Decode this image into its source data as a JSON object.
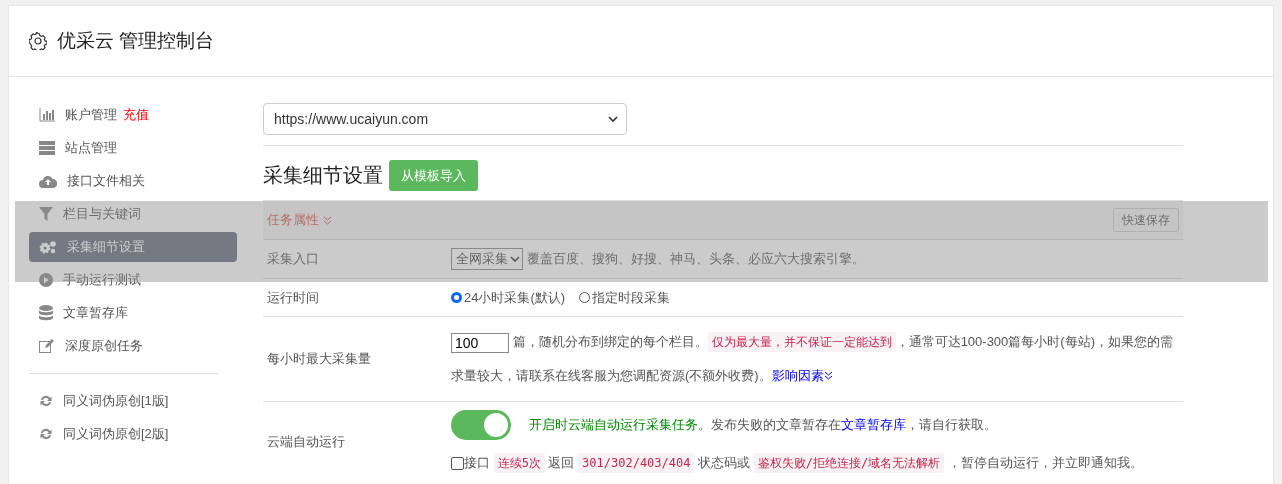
{
  "header": {
    "title": "优采云 管理控制台"
  },
  "sidebar": {
    "sections": [
      {
        "items": [
          {
            "label": "账户管理",
            "badge": "充值",
            "selected": false
          },
          {
            "label": "站点管理",
            "selected": false
          },
          {
            "label": "接口文件相关",
            "selected": false
          },
          {
            "label": "栏目与关键词",
            "selected": false
          },
          {
            "label": "采集细节设置",
            "selected": true
          },
          {
            "label": "手动运行测试",
            "selected": false
          },
          {
            "label": "文章暂存库",
            "selected": false
          },
          {
            "label": "深度原创任务",
            "selected": false
          }
        ]
      },
      {
        "items": [
          {
            "label": "同义词伪原创[1版]",
            "selected": false
          },
          {
            "label": "同义词伪原创[2版]",
            "selected": false
          }
        ]
      }
    ]
  },
  "site_select": {
    "value": "https://www.ucaiyun.com"
  },
  "section": {
    "title": "采集细节设置",
    "import_button": "从模板导入"
  },
  "panel": {
    "title": "任务属性",
    "save_button": "快速保存",
    "rows": [
      {
        "kind": "select",
        "label": "采集入口",
        "value": "全网采集",
        "note": "覆盖百度、搜狗、好搜、神马、头条、必应六大搜索引擎。"
      },
      {
        "kind": "radio",
        "label": "运行时间",
        "options": [
          {
            "label": "24小时采集(默认)",
            "selected": true
          },
          {
            "label": "指定时段采集",
            "selected": false
          }
        ]
      },
      {
        "kind": "number",
        "label": "每小时最大采集量",
        "value": "100",
        "segments": [
          {
            "kind": "text",
            "text": "篇，随机分布到绑定的每个栏目。"
          },
          {
            "kind": "code",
            "text": "仅为最大量，并不保证一定能达到"
          },
          {
            "kind": "text",
            "text": "，通常可达100-300篇每小时(每站)，如果您的需求量较大，请联系在线客服为您调配资源(不额外收费)。"
          },
          {
            "kind": "link",
            "text": "影响因素"
          }
        ]
      },
      {
        "kind": "toggle",
        "label": "云端自动运行",
        "on": true,
        "segments": [
          {
            "kind": "accent",
            "text": "开启时云端自动运行采集任务。"
          },
          {
            "kind": "text",
            "text": "发布失败的文章暂存在"
          },
          {
            "kind": "link",
            "text": "文章暂存库"
          },
          {
            "kind": "text",
            "text": "，请自行获取。"
          }
        ],
        "check": {
          "checked": false,
          "segments": [
            {
              "kind": "text",
              "text": "接口 "
            },
            {
              "kind": "code",
              "text": "连续5次"
            },
            {
              "kind": "text",
              "text": " 返回 "
            },
            {
              "kind": "code",
              "text": "301/302/403/404"
            },
            {
              "kind": "text",
              "text": " 状态码或 "
            },
            {
              "kind": "code",
              "text": "鉴权失败/拒绝连接/域名无法解析"
            },
            {
              "kind": "text",
              "text": " ，暂停自动运行，并立即通知我。"
            }
          ]
        }
      }
    ]
  }
}
